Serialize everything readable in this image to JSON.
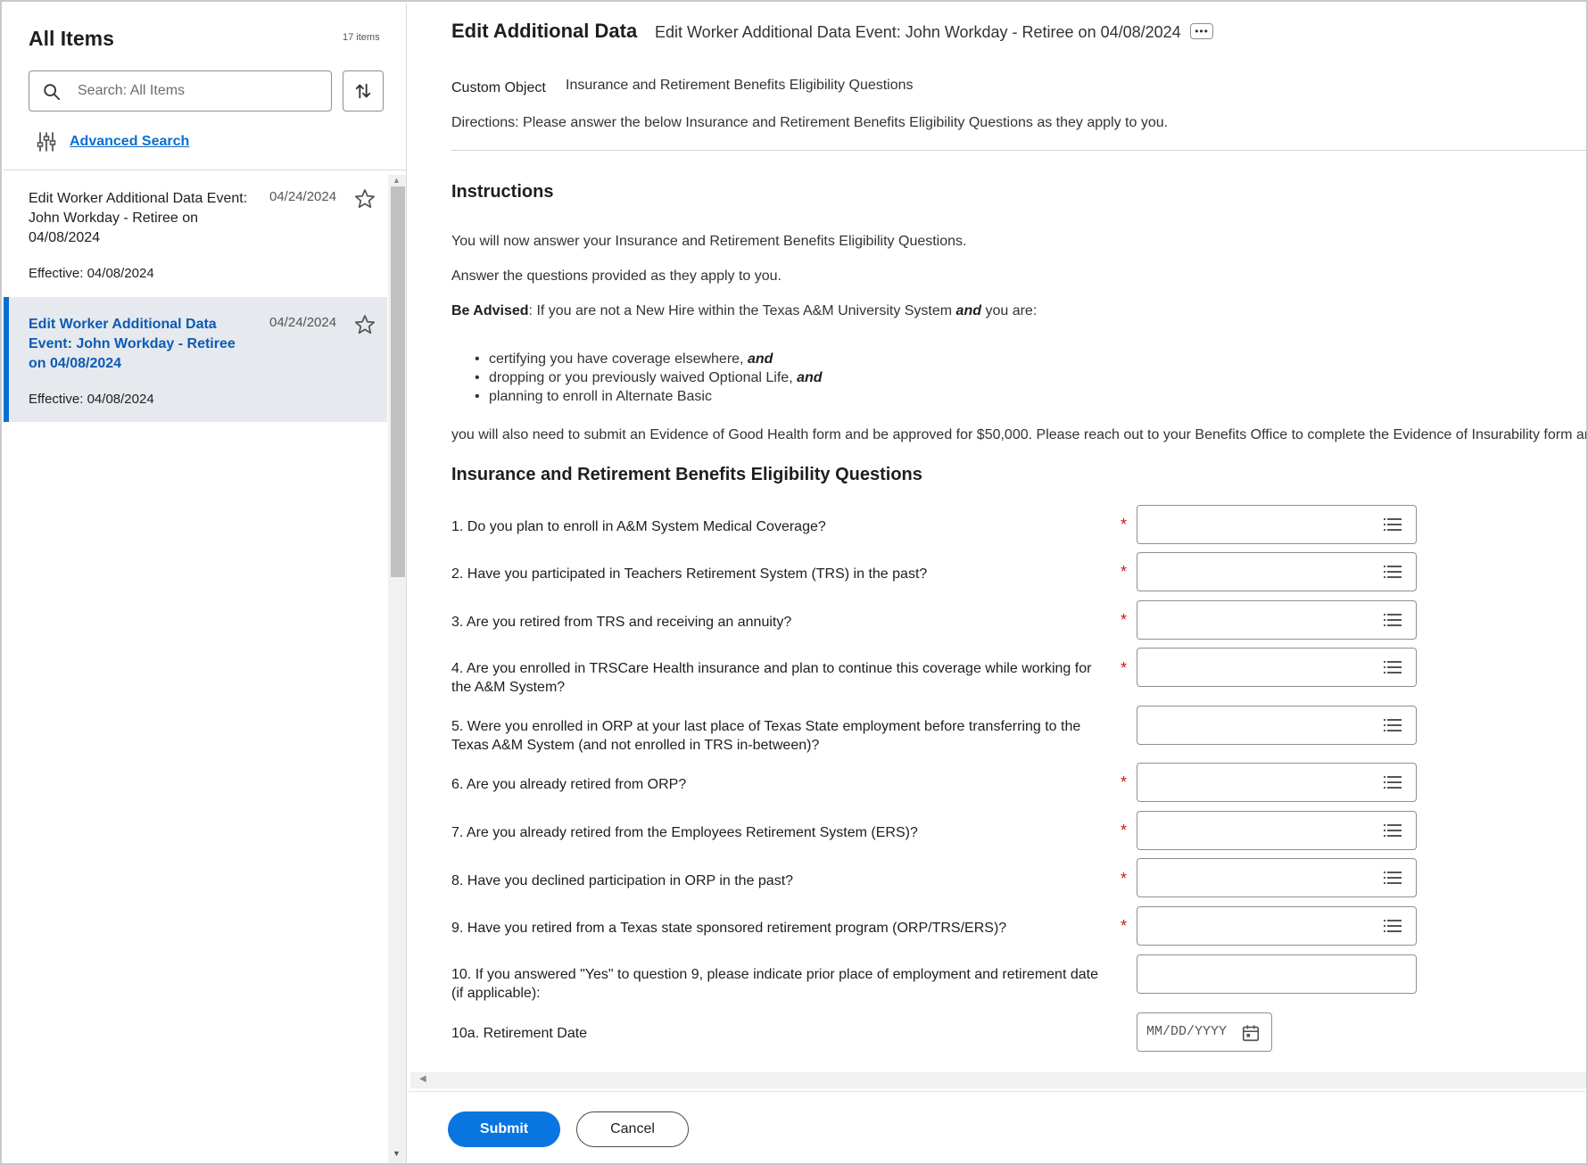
{
  "left_panel": {
    "title": "All Items",
    "count": "17 items",
    "search_placeholder": "Search: All Items",
    "advanced_search": "Advanced Search",
    "items": [
      {
        "title": "Edit Worker Additional Data Event: John Workday - Retiree on 04/08/2024",
        "date": "04/24/2024",
        "effective": "Effective: 04/08/2024",
        "selected": false
      },
      {
        "title": "Edit Worker Additional Data Event: John Workday - Retiree on 04/08/2024",
        "date": "04/24/2024",
        "effective": "Effective: 04/08/2024",
        "selected": true
      }
    ]
  },
  "main": {
    "title": "Edit Additional Data",
    "subtitle": "Edit Worker Additional Data Event: John Workday - Retiree on 04/08/2024",
    "custom_object_label": "Custom Object",
    "custom_object_value": "Insurance and Retirement Benefits Eligibility Questions",
    "directions": "Directions: Please answer the below Insurance and Retirement Benefits Eligibility Questions as they apply to you.",
    "instructions_heading": "Instructions",
    "instr_p1": "You will now answer your Insurance and Retirement Benefits Eligibility Questions.",
    "instr_p2": "Answer the questions provided as they apply to you.",
    "advised_label": "Be Advised",
    "advised_text_1": ": If you are not a New Hire within the Texas A&M University System ",
    "advised_and": "and",
    "advised_text_2": " you are:",
    "bullets": [
      {
        "text": "certifying you have coverage elsewhere, ",
        "emph": "and"
      },
      {
        "text": "dropping or you previously waived Optional Life, ",
        "emph": "and"
      },
      {
        "text": "planning to enroll in Alternate Basic",
        "emph": ""
      }
    ],
    "instr_p4": "you will also need to submit an Evidence of Good Health form and be approved for $50,000. Please reach out to your Benefits Office to complete the Evidence of Insurability form and th",
    "questions_heading": "Insurance and Retirement Benefits Eligibility Questions",
    "questions": [
      {
        "label": "1. Do you plan to enroll in A&M System Medical Coverage?",
        "required": "*"
      },
      {
        "label": "2. Have you participated in Teachers Retirement System (TRS) in the past?",
        "required": "*"
      },
      {
        "label": "3. Are you retired from TRS and receiving an annuity?",
        "required": "*"
      },
      {
        "label": "4. Are you enrolled in TRSCare Health insurance and plan to continue this coverage while working for the A&M System?",
        "required": "*"
      },
      {
        "label": "5. Were you enrolled in ORP at your last place of Texas State employment before transferring to the Texas A&M System (and not enrolled in TRS in-between)?",
        "required": ""
      },
      {
        "label": "6. Are you already retired from ORP?",
        "required": "*"
      },
      {
        "label": "7. Are you already retired from the Employees Retirement System (ERS)?",
        "required": "*"
      },
      {
        "label": "8. Have you declined participation in ORP in the past?",
        "required": "*"
      },
      {
        "label": "9. Have you retired from a Texas state sponsored retirement program (ORP/TRS/ERS)?",
        "required": "*"
      },
      {
        "label": "10. If you answered \"Yes\" to question 9, please indicate prior place of employment and retirement date (if applicable):",
        "required": ""
      },
      {
        "label": "10a. Retirement Date",
        "required": ""
      }
    ],
    "date_placeholder": "MM/DD/YYYY",
    "submit_label": "Submit",
    "cancel_label": "Cancel"
  },
  "colors": {
    "accent": "#0875e1",
    "link": "#0a6ed1",
    "required": "#d0171e",
    "selected_bg": "#e6e9ee"
  }
}
